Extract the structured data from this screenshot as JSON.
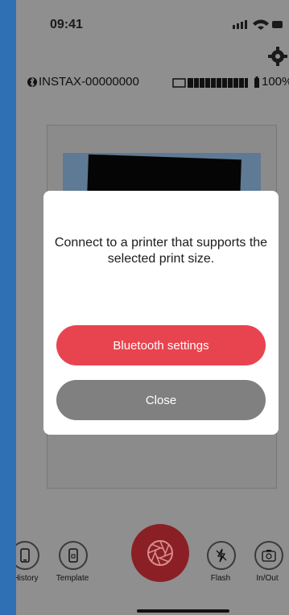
{
  "status_bar": {
    "time": "09:41"
  },
  "printer": {
    "name": "INSTAX-00000000",
    "battery": "100%"
  },
  "dialog": {
    "message": "Connect to a printer that supports the selected print size.",
    "primary_button": "Bluetooth settings",
    "secondary_button": "Close"
  },
  "bottom_nav": {
    "history": "History",
    "template": "Template",
    "flash": "Flash",
    "in_out": "In/Out"
  },
  "colors": {
    "accent": "#e8444f",
    "close_button": "#808080",
    "overlay": "#8f8f8f"
  }
}
